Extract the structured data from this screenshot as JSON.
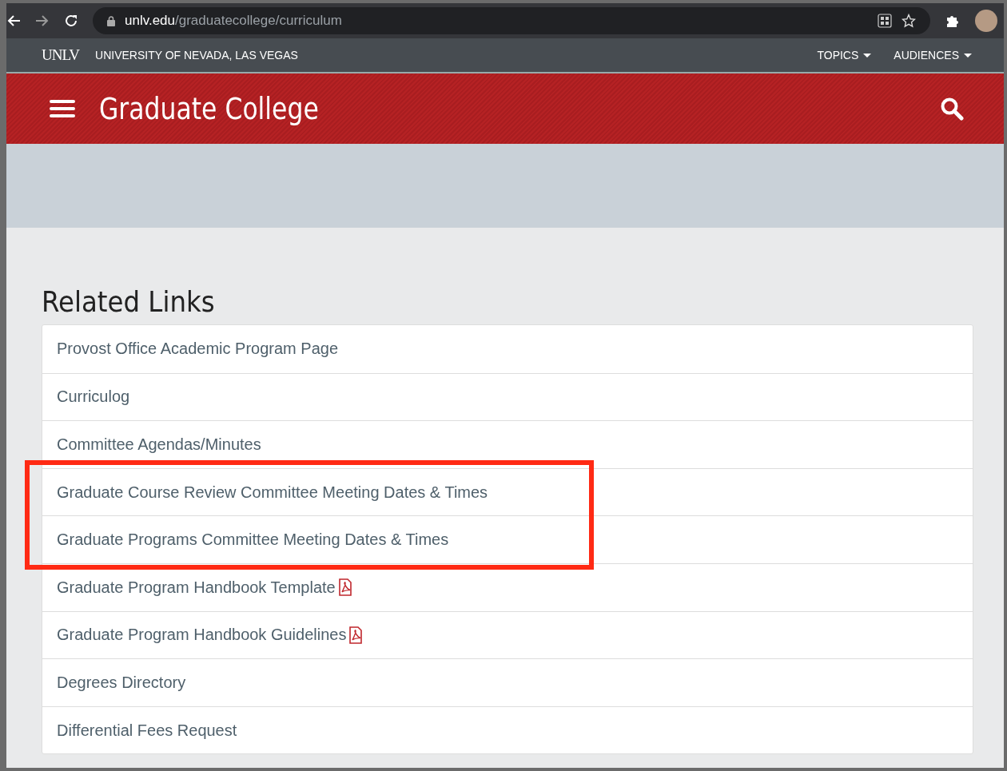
{
  "browser": {
    "url_host": "unlv.edu",
    "url_path": "/graduatecollege/curriculum"
  },
  "topbar": {
    "logo": "UNLV",
    "university": "UNIVERSITY OF NEVADA, LAS VEGAS",
    "menus": [
      "TOPICS",
      "AUDIENCES"
    ]
  },
  "header": {
    "title": "Graduate College"
  },
  "related_links": {
    "heading": "Related Links",
    "links": [
      {
        "label": "Provost Office Academic Program Page",
        "pdf": false,
        "highlighted": false
      },
      {
        "label": "Curriculog",
        "pdf": false,
        "highlighted": false
      },
      {
        "label": "Committee Agendas/Minutes",
        "pdf": false,
        "highlighted": false
      },
      {
        "label": "Graduate Course Review Committee Meeting Dates & Times",
        "pdf": false,
        "highlighted": true
      },
      {
        "label": "Graduate Programs Committee Meeting Dates & Times",
        "pdf": false,
        "highlighted": true
      },
      {
        "label": "Graduate Program Handbook Template",
        "pdf": true,
        "highlighted": false
      },
      {
        "label": "Graduate Program Handbook Guidelines",
        "pdf": true,
        "highlighted": false
      },
      {
        "label": "Degrees Directory",
        "pdf": false,
        "highlighted": false
      },
      {
        "label": "Differential Fees Request",
        "pdf": false,
        "highlighted": false
      }
    ]
  }
}
